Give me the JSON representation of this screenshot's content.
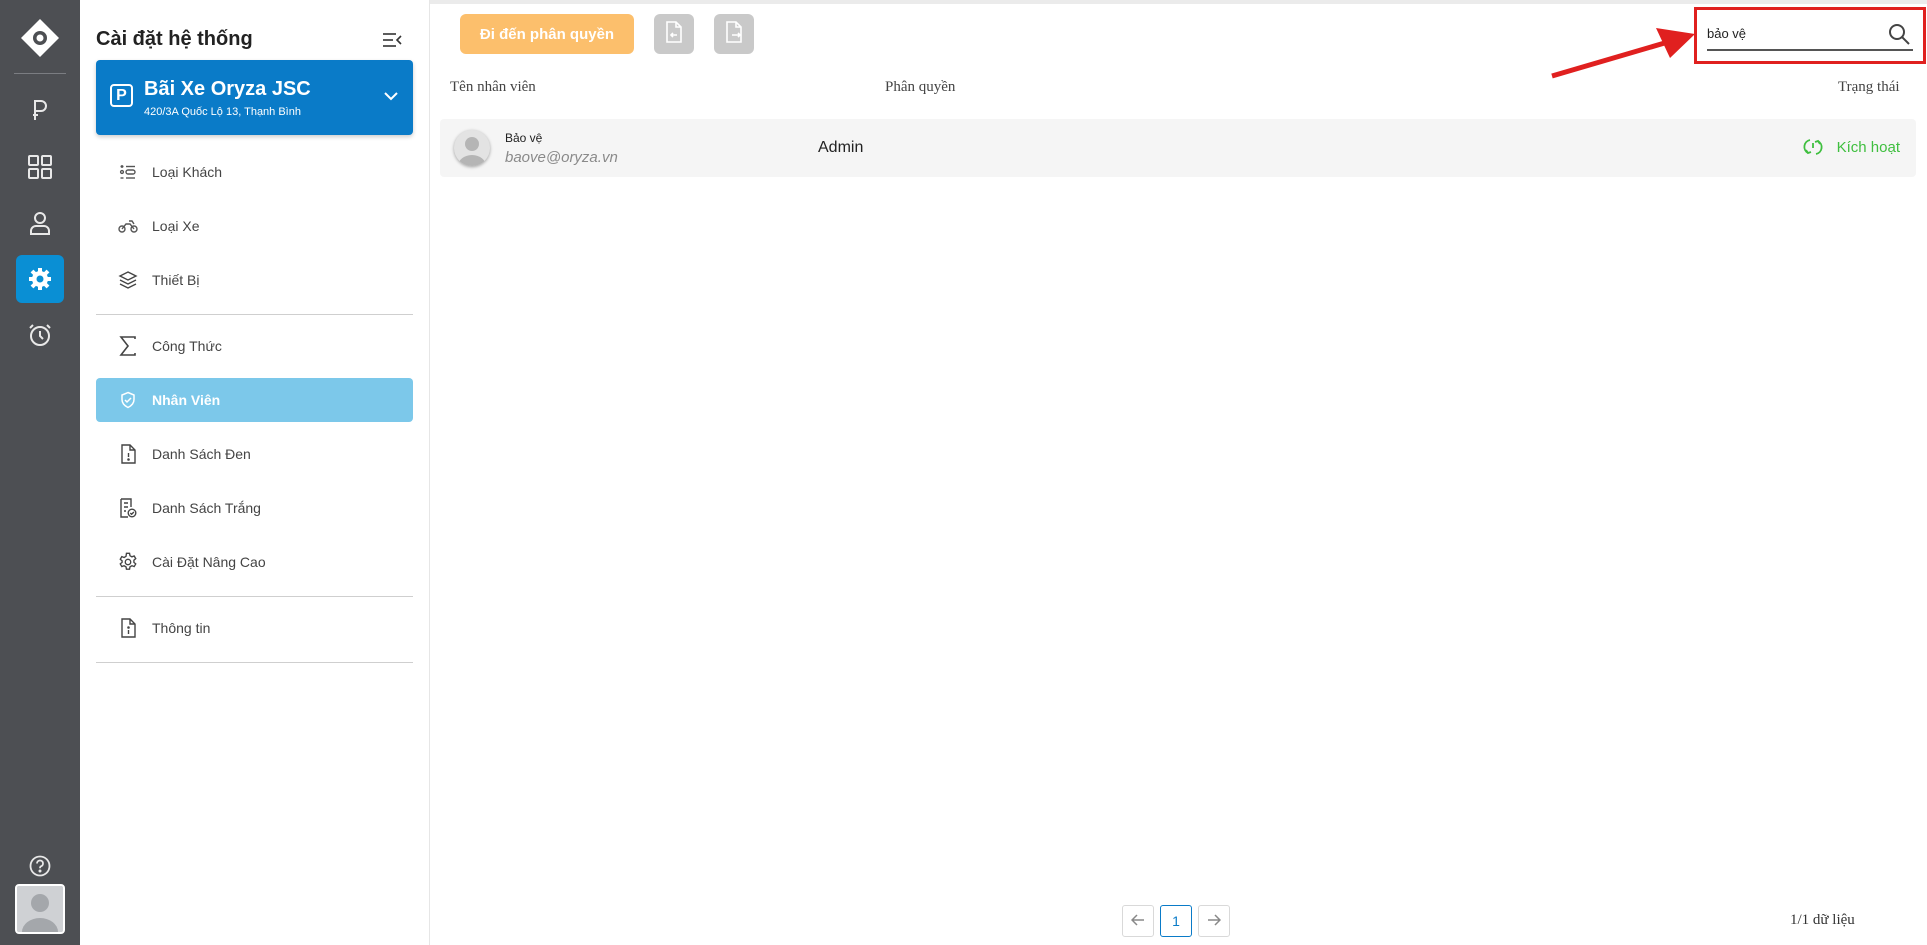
{
  "colors": {
    "rail_bg": "#4d4f53",
    "accent": "#0a7bc8",
    "active_item": "#7cc8ea",
    "perm_button": "#fcbf6c",
    "status_active": "#3fbf3f",
    "highlight": "#e0201f"
  },
  "rail": {
    "items": [
      {
        "icon": "parking-icon"
      },
      {
        "icon": "grid-icon"
      },
      {
        "icon": "user-icon"
      },
      {
        "icon": "settings-icon",
        "active": true
      },
      {
        "icon": "history-icon"
      }
    ],
    "help_icon": "help-icon"
  },
  "panel": {
    "title": "Cài đặt hệ thống",
    "lot": {
      "name": "Bãi Xe Oryza JSC",
      "address": "420/3A Quốc Lộ 13, Thạnh Bình",
      "badge": "P"
    },
    "menu": [
      {
        "label": "Loại Khách",
        "icon": "customer-type-icon"
      },
      {
        "label": "Loại Xe",
        "icon": "motorbike-icon"
      },
      {
        "label": "Thiết Bị",
        "icon": "layers-icon"
      },
      {
        "label": "Công Thức",
        "icon": "sigma-icon"
      },
      {
        "label": "Nhân Viên",
        "icon": "shield-check-icon",
        "active": true
      },
      {
        "label": "Danh Sách Đen",
        "icon": "file-alert-icon"
      },
      {
        "label": "Danh Sách Trắng",
        "icon": "file-check-icon"
      },
      {
        "label": "Cài Đặt Nâng Cao",
        "icon": "gear-icon"
      },
      {
        "label": "Thông tin",
        "icon": "file-info-icon"
      }
    ]
  },
  "toolbar": {
    "perm_button": "Đi đến phân quyền",
    "search": {
      "value": "bảo vệ"
    }
  },
  "table": {
    "headers": {
      "name": "Tên nhân viên",
      "role": "Phân quyền",
      "status": "Trạng thái"
    },
    "rows": [
      {
        "name": "Bảo vệ",
        "email": "baove@oryza.vn",
        "role": "Admin",
        "status": "Kích hoạt"
      }
    ]
  },
  "pagination": {
    "current_page": "1",
    "summary": "1/1 dữ liệu"
  }
}
